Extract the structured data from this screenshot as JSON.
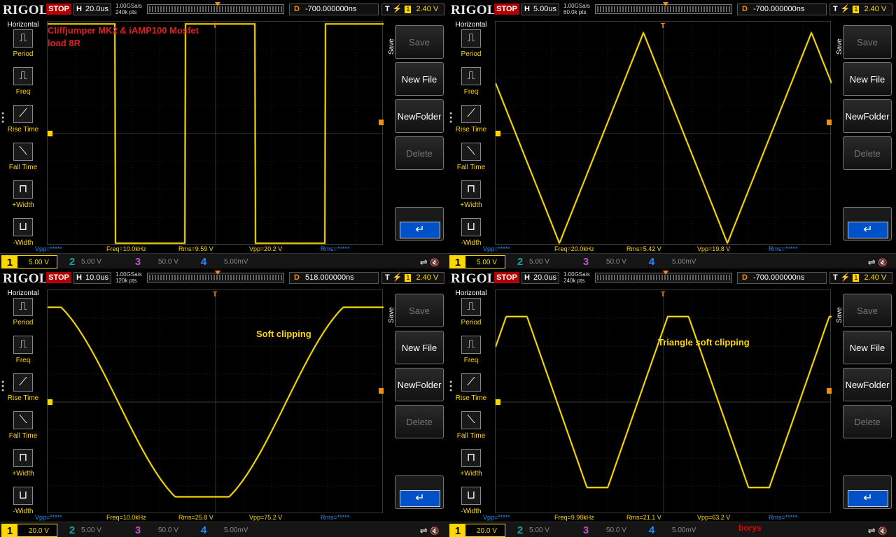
{
  "colors": {
    "ch1": "#ffd700",
    "ch2": "#1aa3a3",
    "ch3": "#c050c0",
    "ch4": "#1e8fff",
    "accent": "#ff8c00",
    "annotation_red": "#e02020",
    "annotation_yellow": "#ffd700"
  },
  "common": {
    "brand": "RIGOL",
    "run_state": "STOP",
    "h_label": "H",
    "d_label": "D",
    "t_label": "T",
    "trig_edge_icon": "rising-edge-icon",
    "trig_channel": "1",
    "left_menu": {
      "title": "Horizontal",
      "items": [
        {
          "label": "Period",
          "icon": "period-icon",
          "glyph": "⎍"
        },
        {
          "label": "Freq",
          "icon": "freq-icon",
          "glyph": "⎍"
        },
        {
          "label": "Rise Time",
          "icon": "rise-time-icon",
          "glyph": "⟋"
        },
        {
          "label": "Fall Time",
          "icon": "fall-time-icon",
          "glyph": "⟍"
        },
        {
          "label": "+Width",
          "icon": "pos-width-icon",
          "glyph": "⊓"
        },
        {
          "label": "-Width",
          "icon": "neg-width-icon",
          "glyph": "⊔"
        }
      ]
    },
    "right_menu": {
      "side_label": "Save",
      "save": "Save",
      "new_file": "New File",
      "new_folder": "NewFolder",
      "delete": "Delete",
      "back_icon": "return-arrow-icon",
      "back_glyph": "↵"
    },
    "ch2_label": "2",
    "ch3_label": "3",
    "ch4_label": "4",
    "ch1_label": "1",
    "ch2_scale": "5.00 V",
    "ch3_scale": "50.0 V",
    "ch4_scale": "5.00mV",
    "usb_icon": "usb-icon",
    "usb_glyph": "⇌",
    "mute_icon": "speaker-mute-icon",
    "mute_glyph": "🔇",
    "meas_vpp_star": "Vpp=*****",
    "meas_rms_star": "Rms=*****",
    "trig_level": "2.40 V"
  },
  "panels": [
    {
      "timebase": "20.0us",
      "sample_rate": "1.00GSa/s",
      "mem_depth": "240k pts",
      "delay": "-700.000000ns",
      "ch1_scale": "5.00 V",
      "meas_freq": "Freq=10.0kHz",
      "meas_rms": "Rms=9.59 V",
      "meas_vpp": "Vpp=20.2 V",
      "annotation_1": "Cliffjumper MK2 & iAMP100 Mosfet",
      "annotation_2": "load 8R",
      "extra": ""
    },
    {
      "timebase": "5.00us",
      "sample_rate": "1.00GSa/s",
      "mem_depth": "60.0k pts",
      "delay": "-700.000000ns",
      "ch1_scale": "5.00 V",
      "meas_freq": "Freq=20.0kHz",
      "meas_rms": "Rms=5.42 V",
      "meas_vpp": "Vpp=19.8 V",
      "annotation_1": "",
      "annotation_2": "",
      "extra": ""
    },
    {
      "timebase": "10.0us",
      "sample_rate": "1.00GSa/s",
      "mem_depth": "120k pts",
      "delay": "518.000000ns",
      "ch1_scale": "20.0 V",
      "meas_freq": "Freq=10.0kHz",
      "meas_rms": "Rms=25.8 V",
      "meas_vpp": "Vpp=75.2 V",
      "annotation_1": "Soft clipping",
      "annotation_2": "",
      "extra": ""
    },
    {
      "timebase": "20.0us",
      "sample_rate": "1.00GSa/s",
      "mem_depth": "240k pts",
      "delay": "-700.000000ns",
      "ch1_scale": "20.0 V",
      "meas_freq": "Freq=9.98kHz",
      "meas_rms": "Rms=21.1 V",
      "meas_vpp": "Vpp=63.2 V",
      "annotation_1": "Triangle soft clipping",
      "annotation_2": "",
      "extra": "borys"
    }
  ]
}
